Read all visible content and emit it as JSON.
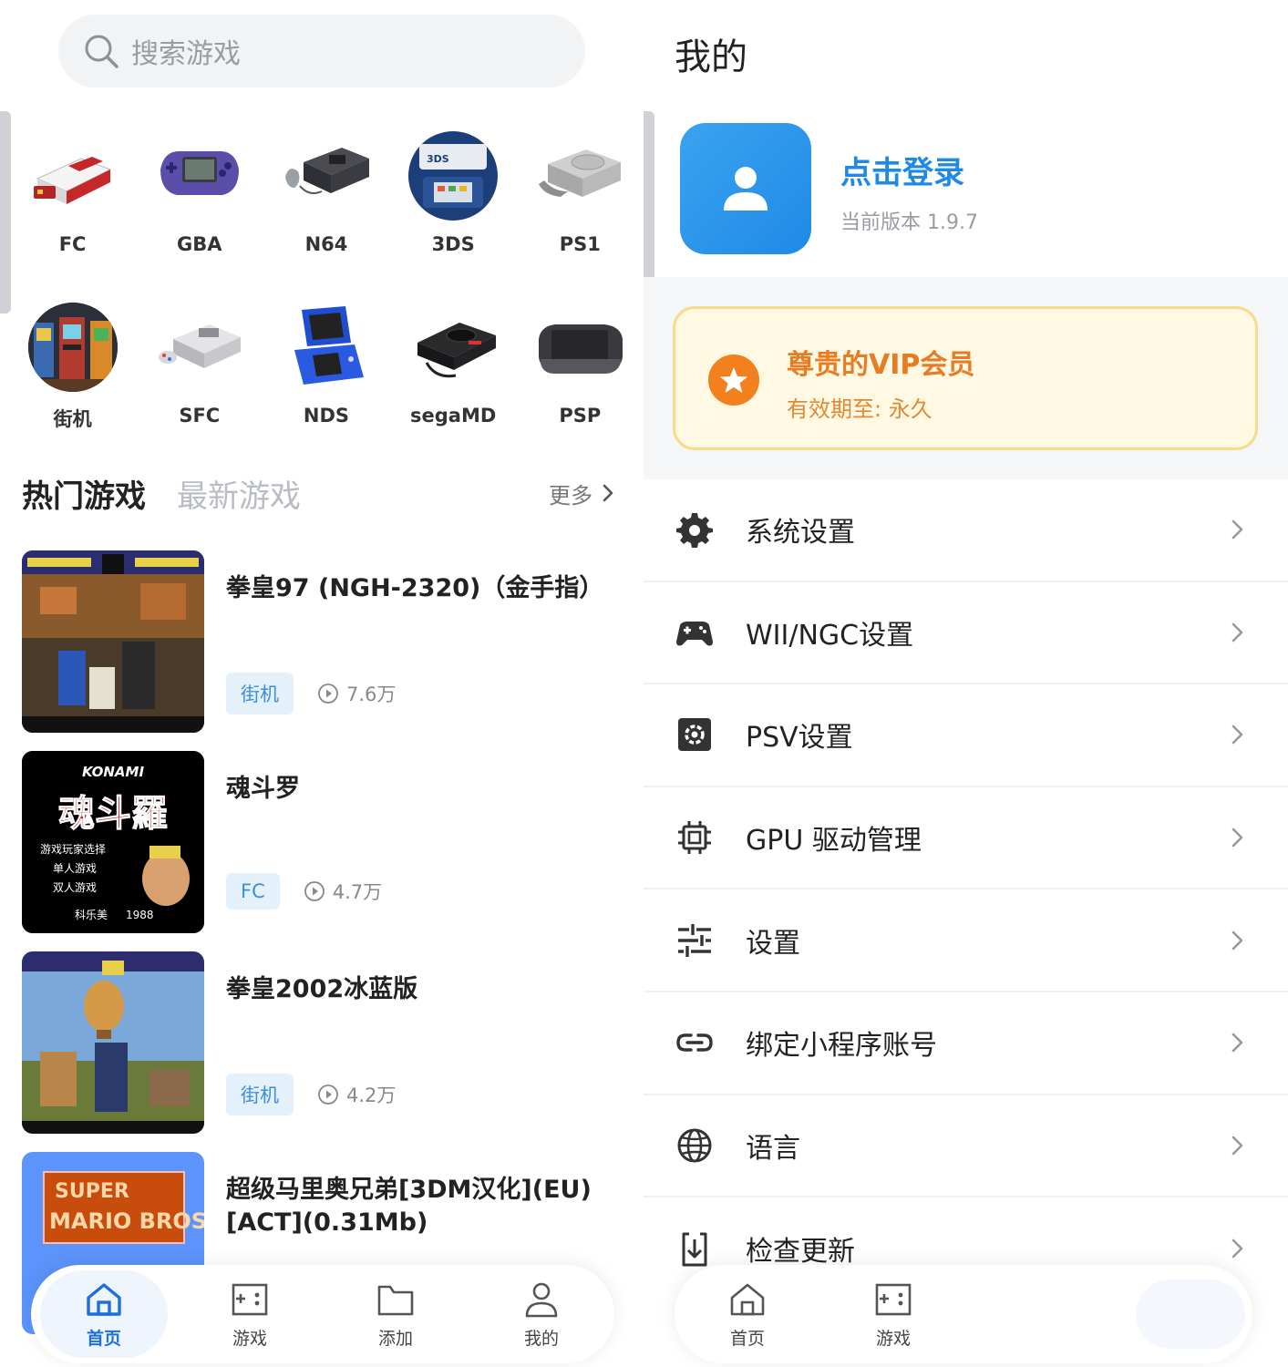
{
  "left": {
    "search": {
      "placeholder": "搜索游戏",
      "icon": "search-icon"
    },
    "consoles": [
      {
        "label": "FC",
        "icon": "famicom-console-icon"
      },
      {
        "label": "GBA",
        "icon": "gba-handheld-icon"
      },
      {
        "label": "N64",
        "icon": "n64-console-icon"
      },
      {
        "label": "3DS",
        "icon": "3ds-handheld-icon"
      },
      {
        "label": "PS1",
        "icon": "ps1-console-icon"
      },
      {
        "label": "街机",
        "icon": "arcade-cabinet-icon"
      },
      {
        "label": "SFC",
        "icon": "sfc-console-icon"
      },
      {
        "label": "NDS",
        "icon": "nds-handheld-icon"
      },
      {
        "label": "segaMD",
        "icon": "sega-md-console-icon"
      },
      {
        "label": "PSP",
        "icon": "psp-handheld-icon"
      }
    ],
    "tabs": {
      "hot": "热门游戏",
      "new": "最新游戏",
      "more": "更多"
    },
    "games": [
      {
        "title": "拳皇97 (NGH-2320)（金手指）",
        "tag": "街机",
        "plays": "7.6万"
      },
      {
        "title": "魂斗罗",
        "tag": "FC",
        "plays": "4.7万"
      },
      {
        "title": "拳皇2002冰蓝版",
        "tag": "街机",
        "plays": "4.2万"
      },
      {
        "title": "超级马里奥兄弟[3DM汉化](EU)[ACT](0.31Mb)",
        "tag": "",
        "plays": ""
      }
    ],
    "thumb_text": {
      "konami": "KONAMI",
      "contra_logo": "魂斗羅",
      "contra_menu_1": "游戏玩家选择",
      "contra_menu_2": "单人游戏",
      "contra_menu_3": "双人游戏",
      "contra_footer_1": "科乐美",
      "contra_footer_2": "1988",
      "mario_1": "SUPER",
      "mario_2": "MARIO BROS."
    },
    "nav": [
      {
        "label": "首页",
        "icon": "home-icon",
        "active": true
      },
      {
        "label": "游戏",
        "icon": "gamepad-icon",
        "active": false
      },
      {
        "label": "添加",
        "icon": "folder-icon",
        "active": false
      },
      {
        "label": "我的",
        "icon": "user-icon",
        "active": false
      }
    ]
  },
  "right": {
    "title": "我的",
    "profile": {
      "login": "点击登录",
      "version": "当前版本 1.9.7"
    },
    "vip": {
      "title": "尊贵的VIP会员",
      "expiry": "有效期至: 永久"
    },
    "menu": [
      {
        "label": "系统设置",
        "icon": "gear-icon"
      },
      {
        "label": "WII/NGC设置",
        "icon": "gamepad-icon"
      },
      {
        "label": "PSV设置",
        "icon": "settings-square-icon"
      },
      {
        "label": "GPU 驱动管理",
        "icon": "chip-icon"
      },
      {
        "label": "设置",
        "icon": "sliders-icon"
      },
      {
        "label": "绑定小程序账号",
        "icon": "link-icon"
      },
      {
        "label": "语言",
        "icon": "globe-icon"
      },
      {
        "label": "检查更新",
        "icon": "download-icon"
      }
    ],
    "nav": [
      {
        "label": "首页",
        "icon": "home-icon"
      },
      {
        "label": "游戏",
        "icon": "gamepad-icon"
      }
    ]
  },
  "colors": {
    "accent_blue": "#1f8ae6",
    "vip_orange": "#e77c23",
    "vip_bg": "#fff8e3",
    "tag_bg": "#e4f1fb",
    "tag_text": "#3d8fd7"
  }
}
